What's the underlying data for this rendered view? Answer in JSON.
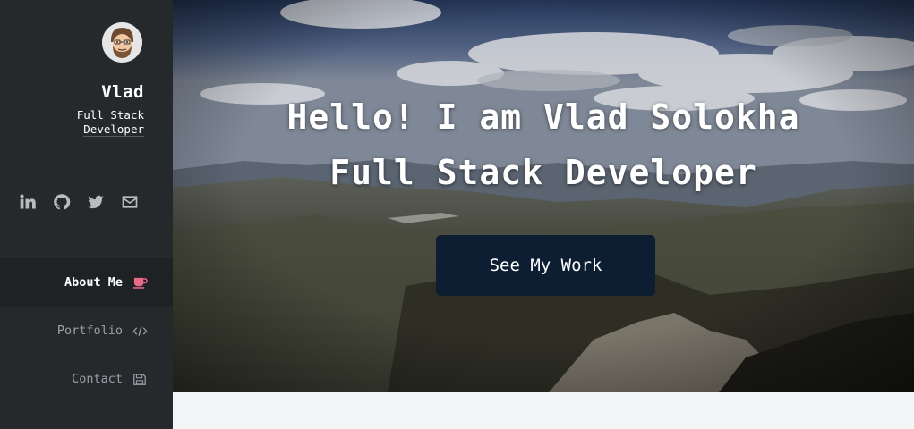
{
  "profile": {
    "name": "Vlad",
    "role": "Full Stack Developer",
    "avatar_icon": "bearded-man-avatar"
  },
  "socials": [
    {
      "icon": "linkedin-icon"
    },
    {
      "icon": "github-icon"
    },
    {
      "icon": "twitter-icon"
    },
    {
      "icon": "mail-icon"
    }
  ],
  "nav": {
    "items": [
      {
        "label": "About Me",
        "icon": "coffee-icon",
        "active": true
      },
      {
        "label": "Portfolio",
        "icon": "code-icon",
        "active": false
      },
      {
        "label": "Contact",
        "icon": "save-icon",
        "active": false
      }
    ]
  },
  "hero": {
    "line1": "Hello! I am Vlad Solokha",
    "line2": "Full Stack Developer",
    "cta_label": "See My Work"
  },
  "colors": {
    "sidebar": "#26292c",
    "sidebar_active": "#1f2225",
    "accent": "#e86a86",
    "cta": "#0d1e33"
  }
}
